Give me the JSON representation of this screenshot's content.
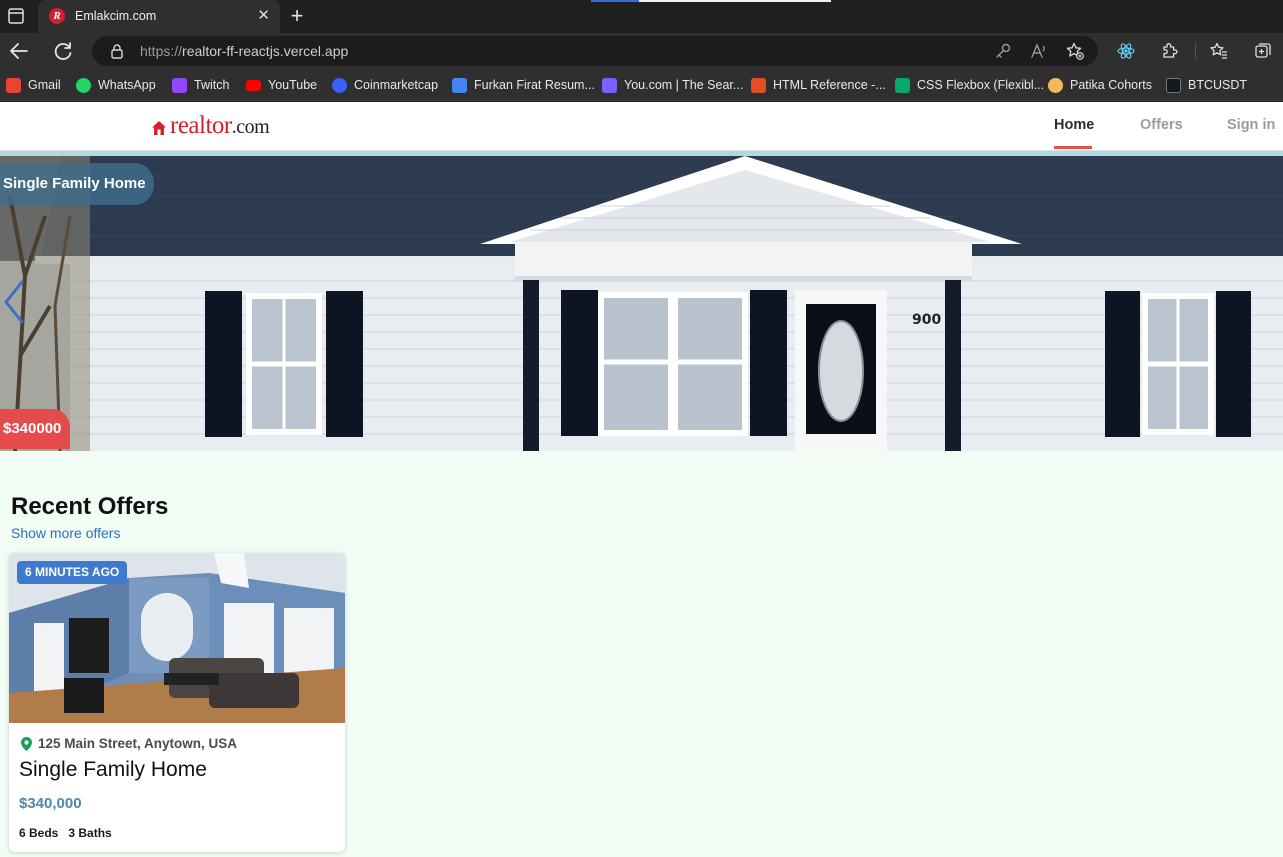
{
  "browser": {
    "tab": {
      "title": "Emlakcim.com",
      "favicon": "R"
    },
    "url": {
      "protocol": "https://",
      "host": "realtor-ff-reactjs.vercel.app"
    },
    "bookmarks": [
      {
        "label": "Gmail",
        "color": "#ea4335"
      },
      {
        "label": "WhatsApp",
        "color": "#25d366"
      },
      {
        "label": "Twitch",
        "color": "#9146ff"
      },
      {
        "label": "YouTube",
        "color": "#ff0000"
      },
      {
        "label": "Coinmarketcap",
        "color": "#3861fb"
      },
      {
        "label": "Furkan Firat Resum...",
        "color": "#4285f4"
      },
      {
        "label": "You.com | The Sear...",
        "color": "#7b61ff"
      },
      {
        "label": "HTML Reference -...",
        "color": "#e44d26"
      },
      {
        "label": "CSS Flexbox (Flexibl...",
        "color": "#04aa6d"
      },
      {
        "label": "Patika Cohorts",
        "color": "#f4b860"
      },
      {
        "label": "BTCUSDT",
        "color": "#131722"
      }
    ]
  },
  "site": {
    "logo": {
      "brand": "realtor",
      "suffix": ".com"
    },
    "nav": {
      "home": "Home",
      "offers": "Offers",
      "signin": "Sign in"
    },
    "hero": {
      "type": "Single Family Home",
      "price": "$340000",
      "house_number": "900"
    },
    "recent": {
      "title": "Recent Offers",
      "more": "Show more offers"
    },
    "card": {
      "time": "6 MINUTES AGO",
      "address": "125 Main Street, Anytown, USA",
      "title": "Single Family Home",
      "price": "$340,000",
      "beds": "6 Beds",
      "baths": "3 Baths"
    }
  },
  "colors": {
    "brand_red": "#d6202a",
    "page_bg": "#f0fcf4",
    "badge_blue": "#3e7bcf",
    "price_red": "#e54b4b",
    "link_blue": "#2e6fbd"
  }
}
